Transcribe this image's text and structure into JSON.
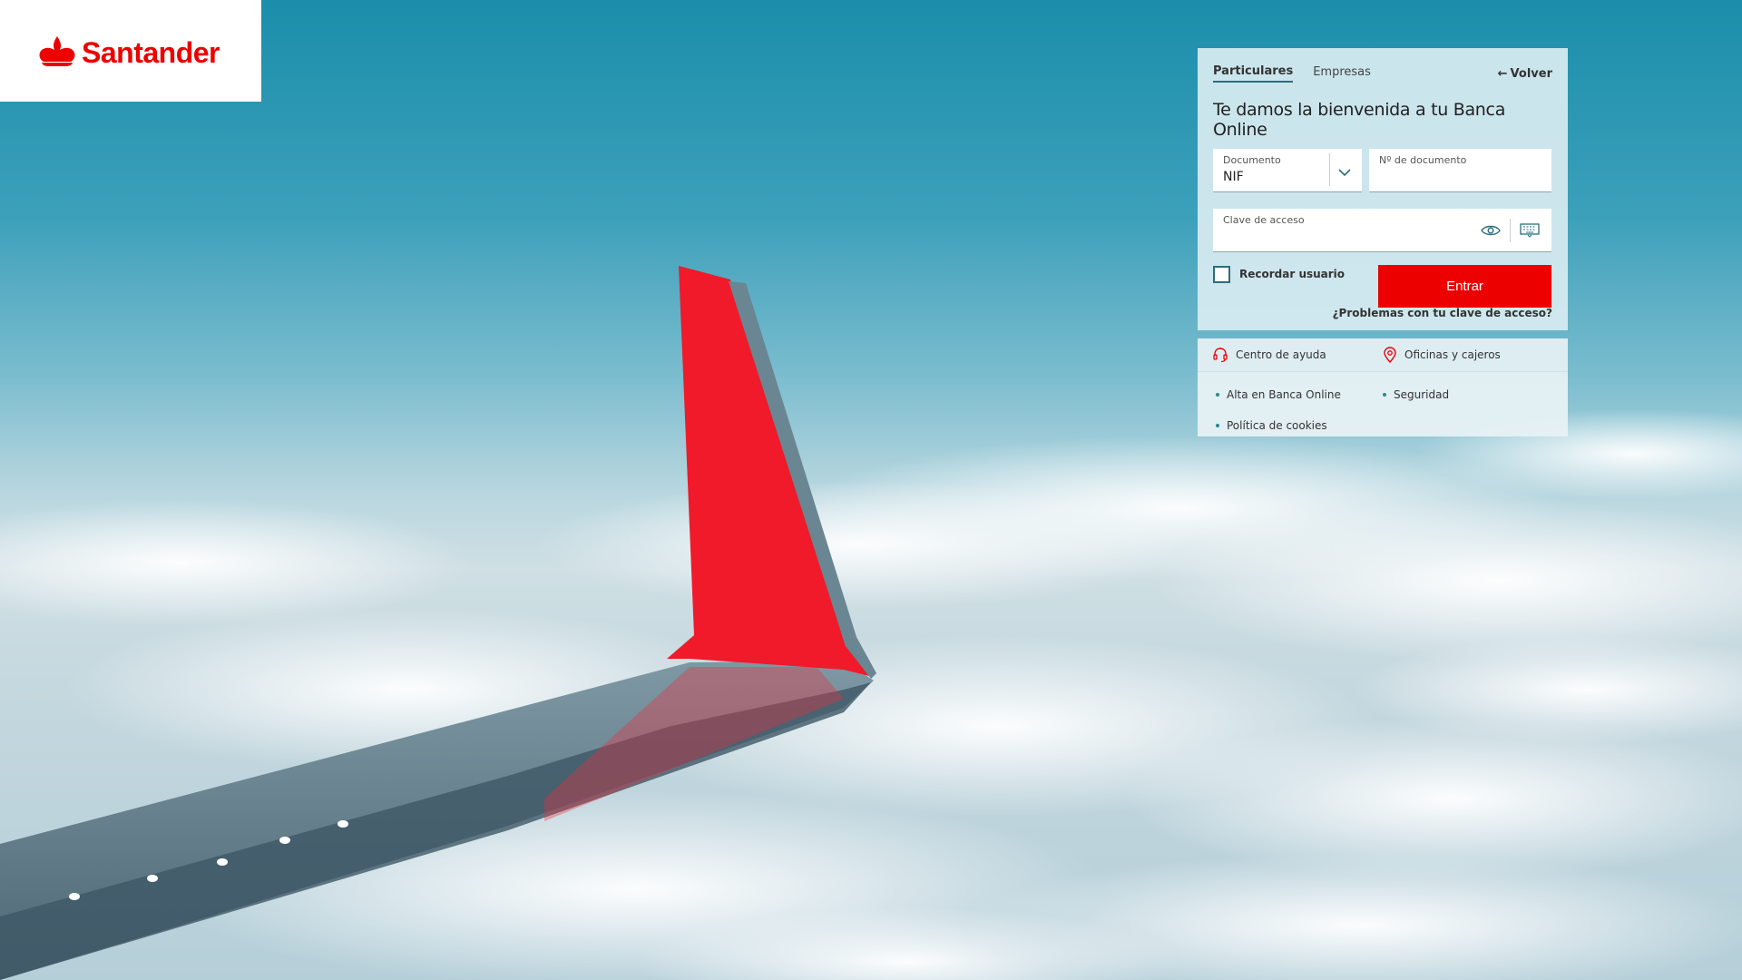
{
  "brand": {
    "name": "Santander",
    "color": "#ec0000"
  },
  "tabs": [
    {
      "label": "Particulares",
      "active": true
    },
    {
      "label": "Empresas",
      "active": false
    }
  ],
  "back_label": "Volver",
  "welcome": "Te damos la bienvenida a tu Banca Online",
  "document": {
    "label": "Documento",
    "value": "NIF"
  },
  "doc_number": {
    "label": "Nº de documento",
    "value": ""
  },
  "password": {
    "label": "Clave de acceso",
    "value": ""
  },
  "remember_label": "Recordar usuario",
  "enter_label": "Entrar",
  "problems_label": "¿Problemas con tu clave de acceso?",
  "help": {
    "center": "Centro de ayuda",
    "offices": "Oficinas y cajeros"
  },
  "links": [
    "Alta en Banca Online",
    "Seguridad",
    "Política de cookies"
  ],
  "icons": {
    "headset": "headset-icon",
    "location": "location-pin-icon",
    "eye": "eye-icon",
    "keyboard": "keyboard-icon",
    "chevron": "chevron-down-icon"
  }
}
